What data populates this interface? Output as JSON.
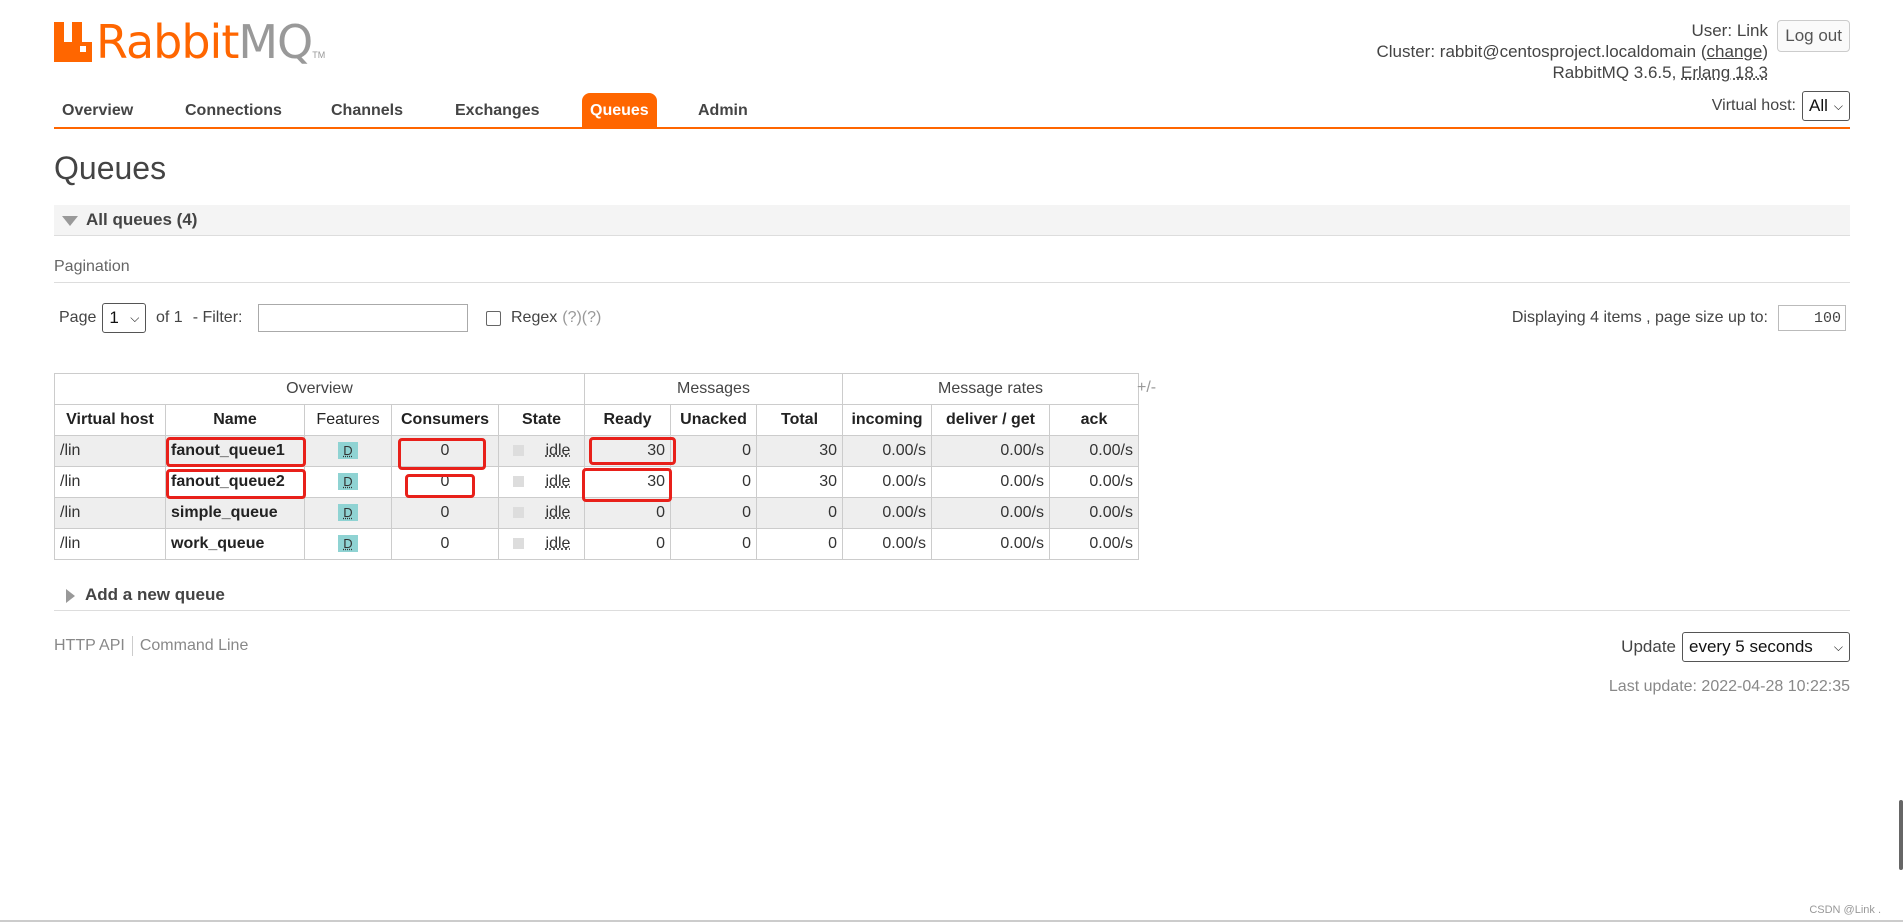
{
  "logo": {
    "rabbit": "Rabbit",
    "mq": "MQ",
    "tm": "TM"
  },
  "login": {
    "user_label": "User:",
    "user": "Link",
    "cluster_label": "Cluster:",
    "cluster": "rabbit@centosproject.localdomain",
    "change_open": "(",
    "change": "change",
    "change_close": ")",
    "version": "RabbitMQ 3.6.5,",
    "erlang": "Erlang 18.3",
    "logout": "Log out"
  },
  "tabs": [
    "Overview",
    "Connections",
    "Channels",
    "Exchanges",
    "Queues",
    "Admin"
  ],
  "active_tab": "Queues",
  "vhost": {
    "label": "Virtual host:",
    "value": "All"
  },
  "page_title": "Queues",
  "section_all": "All queues (4)",
  "pagination": {
    "label": "Pagination",
    "page_label": "Page",
    "page_value": "1",
    "of": "of 1",
    "filter_label": "- Filter:",
    "filter_value": "",
    "regex_label": "Regex",
    "regex_hint": "(?)(?)",
    "display_text": "Displaying 4 items , page size up to:",
    "page_size": "100"
  },
  "table": {
    "groups": [
      "Overview",
      "Messages",
      "Message rates"
    ],
    "plusminus": "+/-",
    "columns": [
      "Virtual host",
      "Name",
      "Features",
      "Consumers",
      "State",
      "Ready",
      "Unacked",
      "Total",
      "incoming",
      "deliver / get",
      "ack"
    ],
    "rows": [
      {
        "vhost": "/lin",
        "name": "fanout_queue1",
        "feature": "D",
        "consumers": "0",
        "state": "idle",
        "ready": "30",
        "unacked": "0",
        "total": "30",
        "incoming": "0.00/s",
        "deliver": "0.00/s",
        "ack": "0.00/s"
      },
      {
        "vhost": "/lin",
        "name": "fanout_queue2",
        "feature": "D",
        "consumers": "0",
        "state": "idle",
        "ready": "30",
        "unacked": "0",
        "total": "30",
        "incoming": "0.00/s",
        "deliver": "0.00/s",
        "ack": "0.00/s"
      },
      {
        "vhost": "/lin",
        "name": "simple_queue",
        "feature": "D",
        "consumers": "0",
        "state": "idle",
        "ready": "0",
        "unacked": "0",
        "total": "0",
        "incoming": "0.00/s",
        "deliver": "0.00/s",
        "ack": "0.00/s"
      },
      {
        "vhost": "/lin",
        "name": "work_queue",
        "feature": "D",
        "consumers": "0",
        "state": "idle",
        "ready": "0",
        "unacked": "0",
        "total": "0",
        "incoming": "0.00/s",
        "deliver": "0.00/s",
        "ack": "0.00/s"
      }
    ]
  },
  "section_add": "Add a new queue",
  "footer": {
    "http_api": "HTTP API",
    "command_line": "Command Line",
    "update_label": "Update",
    "update_value": "every 5 seconds",
    "last_update": "Last update: 2022-04-28 10:22:35"
  },
  "watermark": "CSDN @Link .",
  "colors": {
    "accent": "#ff6600",
    "highlight": "#e8201a",
    "feature_badge": "#8fd3d3"
  }
}
